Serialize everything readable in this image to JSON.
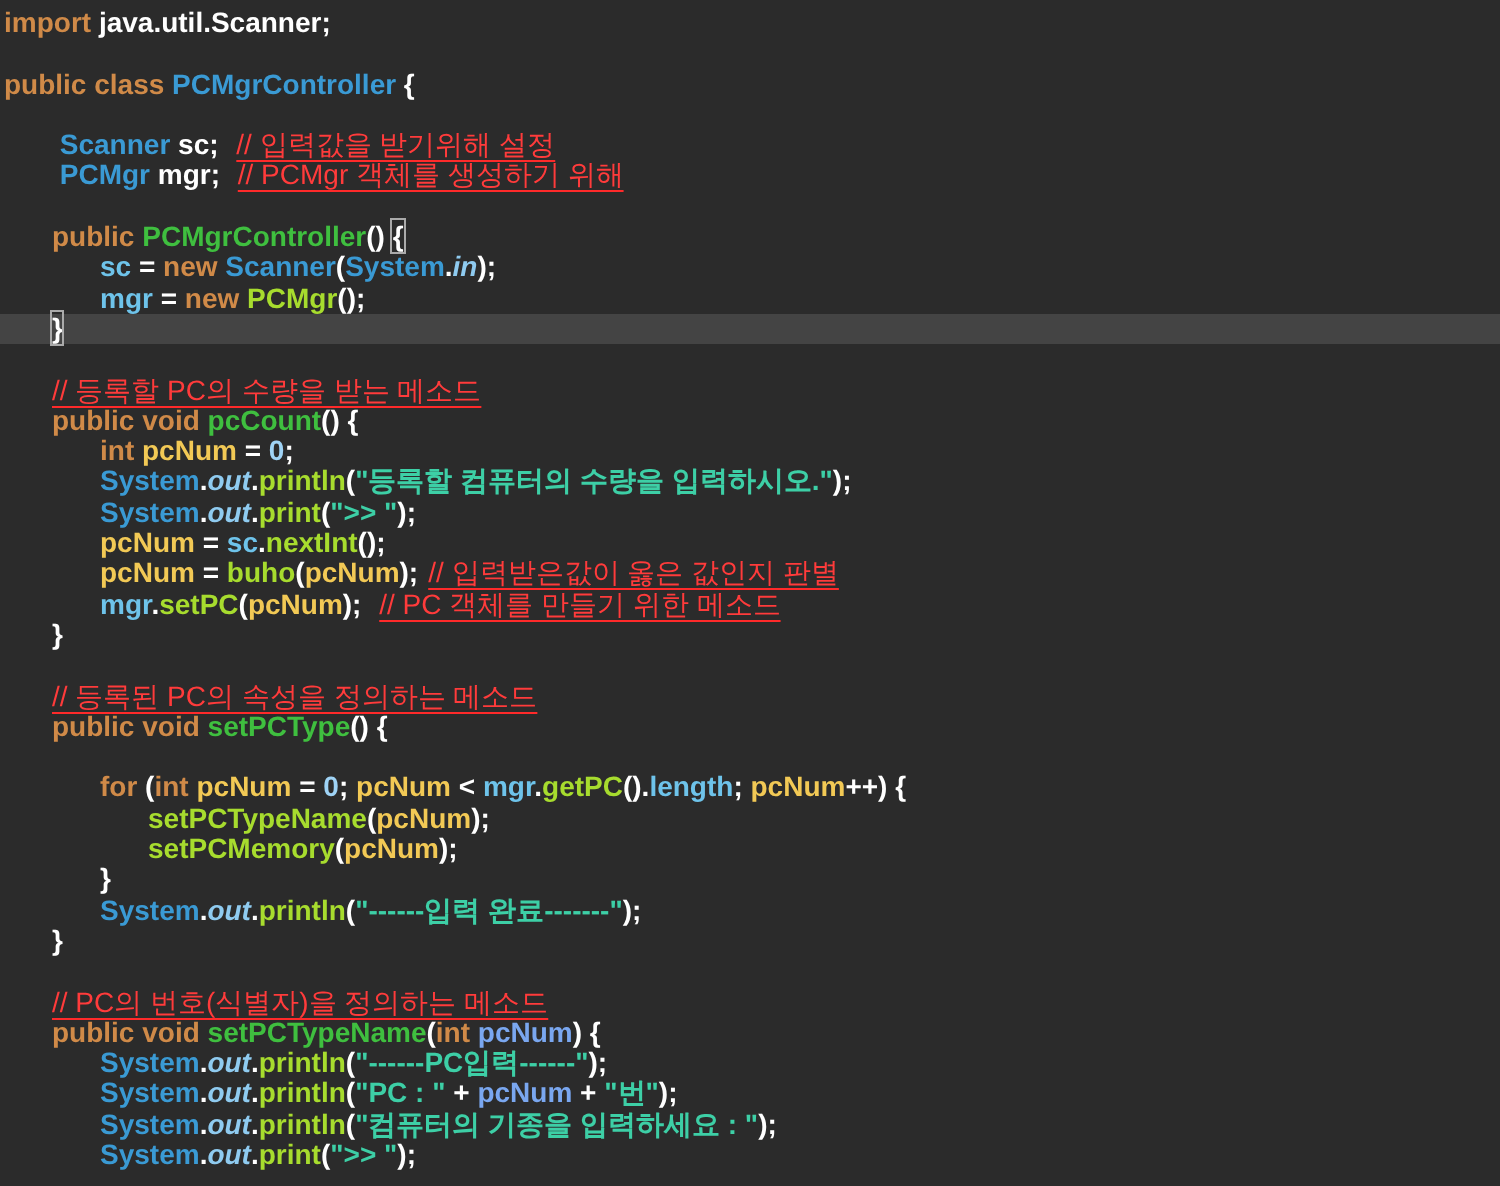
{
  "editor": {
    "lines": [
      {
        "highlighted": false,
        "tokens": [
          {
            "kind": "keyword",
            "text": "import "
          },
          {
            "kind": "plain",
            "text": "java.util.Scanner;"
          }
        ]
      },
      {
        "highlighted": false
      },
      {
        "highlighted": false,
        "tokens": [
          {
            "kind": "keyword",
            "text": "public class "
          },
          {
            "kind": "type",
            "text": "PCMgrController"
          },
          {
            "kind": "plain",
            "text": " {"
          }
        ]
      },
      {
        "highlighted": false
      },
      {
        "highlighted": false,
        "tokens": [
          {
            "kind": "type",
            "text": "\t Scanner"
          },
          {
            "kind": "plain",
            "text": " sc; "
          },
          {
            "kind": "comment",
            "text": "// 입력값을 받기위해 설정"
          }
        ]
      },
      {
        "highlighted": false,
        "tokens": [
          {
            "kind": "type",
            "text": "\t PCMgr"
          },
          {
            "kind": "plain",
            "text": " mgr; "
          },
          {
            "kind": "comment",
            "text": "// PCMgr 객체를 생성하기 위해"
          }
        ]
      },
      {
        "highlighted": false
      },
      {
        "highlighted": false,
        "tokens": [
          {
            "kind": "keyword",
            "text": "\tpublic "
          },
          {
            "kind": "method-def",
            "text": "PCMgrController"
          },
          {
            "kind": "plain",
            "text": "() "
          },
          {
            "kind": "bracket-match",
            "text": "{"
          }
        ]
      },
      {
        "highlighted": false,
        "tokens": [
          {
            "kind": "field",
            "text": "\t\tsc"
          },
          {
            "kind": "plain",
            "text": " = "
          },
          {
            "kind": "keyword",
            "text": "new "
          },
          {
            "kind": "type",
            "text": "Scanner"
          },
          {
            "kind": "plain",
            "text": "("
          },
          {
            "kind": "type",
            "text": "System"
          },
          {
            "kind": "plain",
            "text": "."
          },
          {
            "kind": "static",
            "text": "in"
          },
          {
            "kind": "plain",
            "text": ");"
          }
        ]
      },
      {
        "highlighted": false,
        "tokens": [
          {
            "kind": "field",
            "text": "\t\tmgr"
          },
          {
            "kind": "plain",
            "text": " = "
          },
          {
            "kind": "keyword",
            "text": "new "
          },
          {
            "kind": "call",
            "text": "PCMgr"
          },
          {
            "kind": "plain",
            "text": "();"
          }
        ]
      },
      {
        "highlighted": true,
        "tokens": [
          {
            "kind": "bracket-match",
            "text": "\t}"
          }
        ]
      },
      {
        "highlighted": false
      },
      {
        "highlighted": false,
        "tokens": [
          {
            "kind": "comment",
            "text": "\t// 등록할 PC의 수량을 받는 메소드"
          }
        ]
      },
      {
        "highlighted": false,
        "tokens": [
          {
            "kind": "keyword",
            "text": "\tpublic void "
          },
          {
            "kind": "method-def",
            "text": "pcCount"
          },
          {
            "kind": "plain",
            "text": "() {"
          }
        ]
      },
      {
        "highlighted": false,
        "tokens": [
          {
            "kind": "keyword",
            "text": "\t\tint "
          },
          {
            "kind": "local",
            "text": "pcNum"
          },
          {
            "kind": "plain",
            "text": " = "
          },
          {
            "kind": "number",
            "text": "0"
          },
          {
            "kind": "plain",
            "text": ";"
          }
        ]
      },
      {
        "highlighted": false,
        "tokens": [
          {
            "kind": "type",
            "text": "\t\tSystem"
          },
          {
            "kind": "plain",
            "text": "."
          },
          {
            "kind": "static",
            "text": "out"
          },
          {
            "kind": "plain",
            "text": "."
          },
          {
            "kind": "call",
            "text": "println"
          },
          {
            "kind": "plain",
            "text": "("
          },
          {
            "kind": "string",
            "text": "\"등록할 컴퓨터의 수량을 입력하시오.\""
          },
          {
            "kind": "plain",
            "text": ");"
          }
        ]
      },
      {
        "highlighted": false,
        "tokens": [
          {
            "kind": "type",
            "text": "\t\tSystem"
          },
          {
            "kind": "plain",
            "text": "."
          },
          {
            "kind": "static",
            "text": "out"
          },
          {
            "kind": "plain",
            "text": "."
          },
          {
            "kind": "call",
            "text": "print"
          },
          {
            "kind": "plain",
            "text": "("
          },
          {
            "kind": "string",
            "text": "\">> \""
          },
          {
            "kind": "plain",
            "text": ");"
          }
        ]
      },
      {
        "highlighted": false,
        "tokens": [
          {
            "kind": "local",
            "text": "\t\tpcNum"
          },
          {
            "kind": "plain",
            "text": " = "
          },
          {
            "kind": "field",
            "text": "sc"
          },
          {
            "kind": "plain",
            "text": "."
          },
          {
            "kind": "call",
            "text": "nextInt"
          },
          {
            "kind": "plain",
            "text": "();"
          }
        ]
      },
      {
        "highlighted": false,
        "tokens": [
          {
            "kind": "local",
            "text": "\t\tpcNum"
          },
          {
            "kind": "plain",
            "text": " = "
          },
          {
            "kind": "call",
            "text": "buho"
          },
          {
            "kind": "plain",
            "text": "("
          },
          {
            "kind": "local",
            "text": "pcNum"
          },
          {
            "kind": "plain",
            "text": ");"
          },
          {
            "kind": "comment",
            "text": "// 입력받은값이 옳은 값인지 판별"
          }
        ]
      },
      {
        "highlighted": false,
        "tokens": [
          {
            "kind": "field",
            "text": "\t\tmgr"
          },
          {
            "kind": "plain",
            "text": "."
          },
          {
            "kind": "call",
            "text": "setPC"
          },
          {
            "kind": "plain",
            "text": "("
          },
          {
            "kind": "local",
            "text": "pcNum"
          },
          {
            "kind": "plain",
            "text": "); "
          },
          {
            "kind": "comment",
            "text": "// PC 객체를 만들기 위한 메소드"
          }
        ]
      },
      {
        "highlighted": false,
        "tokens": [
          {
            "kind": "plain",
            "text": "\t}"
          }
        ]
      },
      {
        "highlighted": false
      },
      {
        "highlighted": false,
        "tokens": [
          {
            "kind": "comment",
            "text": "\t// 등록된 PC의 속성을 정의하는 메소드"
          }
        ]
      },
      {
        "highlighted": false,
        "tokens": [
          {
            "kind": "keyword",
            "text": "\tpublic void "
          },
          {
            "kind": "method-def",
            "text": "setPCType"
          },
          {
            "kind": "plain",
            "text": "() {"
          }
        ]
      },
      {
        "highlighted": false
      },
      {
        "highlighted": false,
        "tokens": [
          {
            "kind": "keyword",
            "text": "\t\tfor"
          },
          {
            "kind": "plain",
            "text": " ("
          },
          {
            "kind": "keyword",
            "text": "int "
          },
          {
            "kind": "local",
            "text": "pcNum"
          },
          {
            "kind": "plain",
            "text": " = "
          },
          {
            "kind": "number",
            "text": "0"
          },
          {
            "kind": "plain",
            "text": "; "
          },
          {
            "kind": "local",
            "text": "pcNum"
          },
          {
            "kind": "plain",
            "text": " < "
          },
          {
            "kind": "field",
            "text": "mgr"
          },
          {
            "kind": "plain",
            "text": "."
          },
          {
            "kind": "call",
            "text": "getPC"
          },
          {
            "kind": "plain",
            "text": "()."
          },
          {
            "kind": "field",
            "text": "length"
          },
          {
            "kind": "plain",
            "text": "; "
          },
          {
            "kind": "local",
            "text": "pcNum"
          },
          {
            "kind": "plain",
            "text": "++) {"
          }
        ]
      },
      {
        "highlighted": false,
        "tokens": [
          {
            "kind": "call",
            "text": "\t\t\tsetPCTypeName"
          },
          {
            "kind": "plain",
            "text": "("
          },
          {
            "kind": "local",
            "text": "pcNum"
          },
          {
            "kind": "plain",
            "text": ");"
          }
        ]
      },
      {
        "highlighted": false,
        "tokens": [
          {
            "kind": "call",
            "text": "\t\t\tsetPCMemory"
          },
          {
            "kind": "plain",
            "text": "("
          },
          {
            "kind": "local",
            "text": "pcNum"
          },
          {
            "kind": "plain",
            "text": ");"
          }
        ]
      },
      {
        "highlighted": false,
        "tokens": [
          {
            "kind": "plain",
            "text": "\t\t}"
          }
        ]
      },
      {
        "highlighted": false,
        "tokens": [
          {
            "kind": "type",
            "text": "\t\tSystem"
          },
          {
            "kind": "plain",
            "text": "."
          },
          {
            "kind": "static",
            "text": "out"
          },
          {
            "kind": "plain",
            "text": "."
          },
          {
            "kind": "call",
            "text": "println"
          },
          {
            "kind": "plain",
            "text": "("
          },
          {
            "kind": "string",
            "text": "\"------입력 완료-------\""
          },
          {
            "kind": "plain",
            "text": ");"
          }
        ]
      },
      {
        "highlighted": false,
        "tokens": [
          {
            "kind": "plain",
            "text": "\t}"
          }
        ]
      },
      {
        "highlighted": false
      },
      {
        "highlighted": false,
        "tokens": [
          {
            "kind": "comment",
            "text": "\t// PC의 번호(식별자)을 정의하는 메소드"
          }
        ]
      },
      {
        "highlighted": false,
        "tokens": [
          {
            "kind": "keyword",
            "text": "\tpublic void "
          },
          {
            "kind": "method-def",
            "text": "setPCTypeName"
          },
          {
            "kind": "plain",
            "text": "("
          },
          {
            "kind": "keyword",
            "text": "int "
          },
          {
            "kind": "param",
            "text": "pcNum"
          },
          {
            "kind": "plain",
            "text": ") {"
          }
        ]
      },
      {
        "highlighted": false,
        "tokens": [
          {
            "kind": "type",
            "text": "\t\tSystem"
          },
          {
            "kind": "plain",
            "text": "."
          },
          {
            "kind": "static",
            "text": "out"
          },
          {
            "kind": "plain",
            "text": "."
          },
          {
            "kind": "call",
            "text": "println"
          },
          {
            "kind": "plain",
            "text": "("
          },
          {
            "kind": "string",
            "text": "\"------PC입력------\""
          },
          {
            "kind": "plain",
            "text": ");"
          }
        ]
      },
      {
        "highlighted": false,
        "tokens": [
          {
            "kind": "type",
            "text": "\t\tSystem"
          },
          {
            "kind": "plain",
            "text": "."
          },
          {
            "kind": "static",
            "text": "out"
          },
          {
            "kind": "plain",
            "text": "."
          },
          {
            "kind": "call",
            "text": "println"
          },
          {
            "kind": "plain",
            "text": "("
          },
          {
            "kind": "string",
            "text": "\"PC : \""
          },
          {
            "kind": "plain",
            "text": " + "
          },
          {
            "kind": "param",
            "text": "pcNum"
          },
          {
            "kind": "plain",
            "text": " + "
          },
          {
            "kind": "string",
            "text": "\"번\""
          },
          {
            "kind": "plain",
            "text": ");"
          }
        ]
      },
      {
        "highlighted": false,
        "tokens": [
          {
            "kind": "type",
            "text": "\t\tSystem"
          },
          {
            "kind": "plain",
            "text": "."
          },
          {
            "kind": "static",
            "text": "out"
          },
          {
            "kind": "plain",
            "text": "."
          },
          {
            "kind": "call",
            "text": "println"
          },
          {
            "kind": "plain",
            "text": "("
          },
          {
            "kind": "string",
            "text": "\"컴퓨터의 기종을 입력하세요 : \""
          },
          {
            "kind": "plain",
            "text": ");"
          }
        ]
      },
      {
        "highlighted": false,
        "tokens": [
          {
            "kind": "type",
            "text": "\t\tSystem"
          },
          {
            "kind": "plain",
            "text": "."
          },
          {
            "kind": "static",
            "text": "out"
          },
          {
            "kind": "plain",
            "text": "."
          },
          {
            "kind": "call",
            "text": "print"
          },
          {
            "kind": "plain",
            "text": "("
          },
          {
            "kind": "string",
            "text": "\">> \""
          },
          {
            "kind": "plain",
            "text": ");"
          }
        ]
      }
    ]
  }
}
